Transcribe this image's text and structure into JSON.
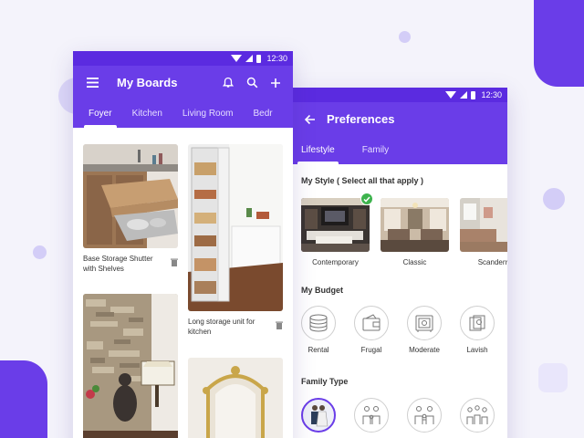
{
  "colors": {
    "primary": "#6a3de8",
    "status": "#5b2be0",
    "check": "#3db34d"
  },
  "status_bar": {
    "time": "12:30"
  },
  "boards_screen": {
    "title": "My Boards",
    "menu_icon": "hamburger-icon",
    "actions": [
      "bell-icon",
      "search-icon",
      "plus-icon"
    ],
    "tabs": [
      {
        "label": "Foyer",
        "active": true
      },
      {
        "label": "Kitchen",
        "active": false
      },
      {
        "label": "Living Room",
        "active": false
      },
      {
        "label": "Bedr",
        "active": false
      }
    ],
    "cards": [
      {
        "caption": "Base Storage Shutter with Shelves"
      },
      {
        "caption": "Long storage unit for kitchen"
      },
      {
        "caption": ""
      },
      {
        "caption": ""
      }
    ]
  },
  "preferences_screen": {
    "title": "Preferences",
    "back_icon": "arrow-left-icon",
    "tabs": [
      {
        "label": "Lifestyle",
        "active": true
      },
      {
        "label": "Family",
        "active": false
      }
    ],
    "style_section": {
      "title": "My Style ( Select all that apply )",
      "items": [
        {
          "label": "Contemporary",
          "selected": true
        },
        {
          "label": "Classic",
          "selected": false
        },
        {
          "label": "Scandenv",
          "selected": false
        }
      ]
    },
    "budget_section": {
      "title": "My Budget",
      "items": [
        {
          "label": "Rental",
          "icon": "coins-icon"
        },
        {
          "label": "Frugal",
          "icon": "wallet-icon"
        },
        {
          "label": "Moderate",
          "icon": "safe-icon"
        },
        {
          "label": "Lavish",
          "icon": "money-stack-icon"
        }
      ]
    },
    "family_section": {
      "title": "Family Type",
      "items": [
        {
          "icon": "couple-icon",
          "selected": true
        },
        {
          "icon": "family-icon",
          "selected": false
        },
        {
          "icon": "family-kids-icon",
          "selected": false
        },
        {
          "icon": "joint-family-icon",
          "selected": false
        }
      ]
    }
  }
}
